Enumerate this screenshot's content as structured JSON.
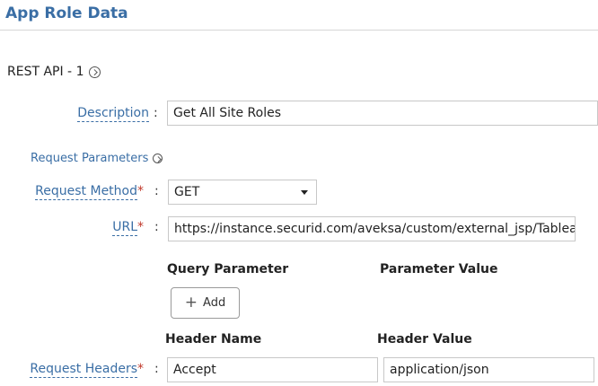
{
  "header": {
    "title": "App Role Data"
  },
  "section": {
    "title": "REST API - 1",
    "icon": "chevron-right-circle-icon"
  },
  "description": {
    "label": "Description",
    "colon": ":",
    "value": "Get All Site Roles"
  },
  "request_parameters": {
    "label": "Request Parameters",
    "icon": "chevron-right-circle-icon"
  },
  "request_method": {
    "label": "Request Method",
    "required": "*",
    "colon": ":",
    "value": "GET"
  },
  "url": {
    "label": "URL",
    "required": "*",
    "colon": ":",
    "value": "https://instance.securid.com/aveksa/custom/external_jsp/TableauS"
  },
  "query": {
    "param_header": "Query Parameter",
    "value_header": "Parameter Value",
    "add_label": "Add"
  },
  "headers": {
    "name_header": "Header Name",
    "value_header": "Header Value",
    "label": "Request Headers",
    "required": "*",
    "colon": ":",
    "rows": [
      {
        "name": "Accept",
        "value": "application/json"
      }
    ]
  },
  "colors": {
    "accent": "#3a6ea5",
    "required": "#c0392b"
  }
}
